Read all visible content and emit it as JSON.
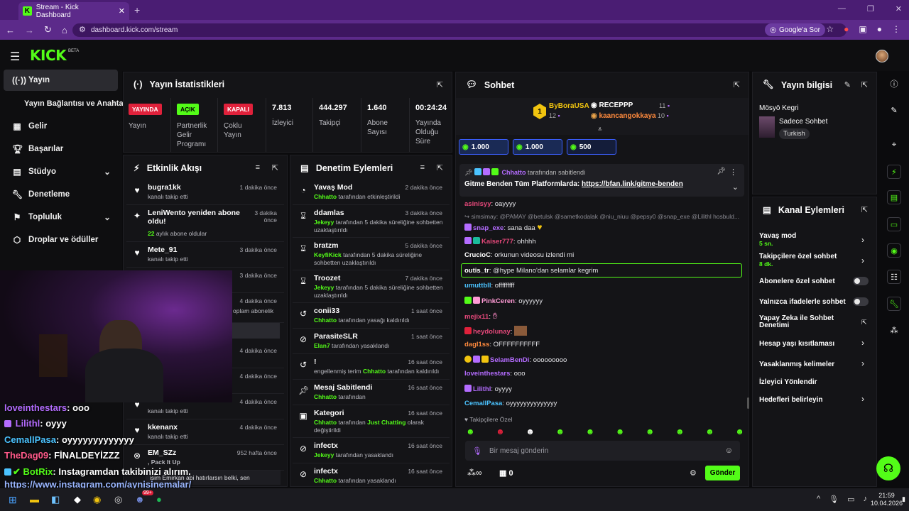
{
  "browser": {
    "tab_title": "Stream - Kick Dashboard",
    "url": "dashboard.kick.com/stream",
    "search_chip": "Google'a Sor"
  },
  "app": {
    "logo": "KICK",
    "beta": "BETA"
  },
  "sidebar": {
    "items": [
      {
        "label": "Yayın",
        "icon": "broadcast-icon"
      },
      {
        "label": "Yayın Bağlantısı ve Anahtarı",
        "icon": ""
      },
      {
        "label": "Gelir",
        "icon": "revenue-icon"
      },
      {
        "label": "Başarılar",
        "icon": "trophy-icon"
      },
      {
        "label": "Stüdyo",
        "icon": "studio-icon"
      },
      {
        "label": "Denetleme",
        "icon": "wrench-icon"
      },
      {
        "label": "Topluluk",
        "icon": "community-icon"
      },
      {
        "label": "Droplar ve ödüller",
        "icon": "drops-icon"
      }
    ]
  },
  "stats": {
    "title": "Yayın İstatistikleri",
    "cells": [
      {
        "badge": "YAYINDA",
        "label": "Yayın"
      },
      {
        "badge": "AÇIK",
        "label": "Partnerlik Gelir Programı"
      },
      {
        "badge": "KAPALI",
        "label": "Çoklu Yayın"
      },
      {
        "value": "7.813",
        "label": "İzleyici"
      },
      {
        "value": "444.297",
        "label": "Takipçi"
      },
      {
        "value": "1.640",
        "label": "Abone Sayısı"
      },
      {
        "value": "00:24:24",
        "label": "Yayında Olduğu Süre"
      }
    ]
  },
  "activity": {
    "title": "Etkinlik Akışı",
    "items": [
      {
        "name": "bugra1kk",
        "sub": "kanalı takip etti",
        "time": "1 dakika önce"
      },
      {
        "name": "LeniWento yeniden abone oldu!",
        "sub_num": "22",
        "sub": " aylık abone oldular",
        "time": "3 dakika önce"
      },
      {
        "name": "Mete_91",
        "sub": "kanalı takip etti",
        "time": "3 dakika önce"
      },
      {
        "time": "3 dakika önce"
      },
      {
        "sub": "oplam abonelik",
        "time": "4 dakika önce"
      },
      {
        "time": "4 dakika önce"
      },
      {
        "time": "4 dakika önce"
      },
      {
        "sub": "kanalı takip etti",
        "time": "4 dakika önce"
      },
      {
        "name": "kkenanx",
        "sub": "kanalı takip etti",
        "time": "4 dakika önce"
      },
      {
        "name": "EM_SZz",
        "sub": ", Pack It Up",
        "time": "952 hafta önce"
      },
      {
        "sub": "isim Emirkan abi hatırlarsın belki, sen"
      }
    ]
  },
  "moderation": {
    "title": "Denetim Eylemleri",
    "items": [
      {
        "name": "Yavaş Mod",
        "actor": "Chhatto",
        "rest": " tarafından etkinleştirildi",
        "time": "2 dakika önce"
      },
      {
        "name": "ddamlas",
        "actor": "Jekeyy",
        "rest": " tarafından 5 dakika süreliğine sohbetten uzaklaştırıldı",
        "time": "3 dakika önce"
      },
      {
        "name": "bratzm",
        "actor": "KeyfiKick",
        "rest": " tarafından 5 dakika süreliğine sohbetten uzaklaştırıldı",
        "time": "5 dakika önce"
      },
      {
        "name": "Troozet",
        "actor": "Jekeyy",
        "rest": " tarafından 5 dakika süreliğine sohbetten uzaklaştırıldı",
        "time": "7 dakika önce"
      },
      {
        "name": "conii33",
        "actor": "Chhatto",
        "rest": " tarafından yasağı kaldırıldı",
        "time": "1 saat önce"
      },
      {
        "name": "ParasiteSLR",
        "actor": "Elan7",
        "rest": " tarafından yasaklandı",
        "time": "1 saat önce"
      },
      {
        "name": "!",
        "pre": "engellenmiş terim ",
        "actor": "Chhatto",
        "rest": " tarafından kaldırıldı",
        "time": "16 saat önce"
      },
      {
        "name": "Mesaj Sabitlendi",
        "actor": "Chhatto",
        "rest": " tarafından",
        "time": "16 saat önce"
      },
      {
        "name": "Kategori",
        "actor": "Chhatto",
        "rest": " tarafından ",
        "actor2": "Just Chatting",
        "rest2": " olarak değiştirildi",
        "time": "16 saat önce"
      },
      {
        "name": "infectx",
        "actor": "Jekeyy",
        "rest": " tarafından yasaklandı",
        "time": "16 saat önce"
      },
      {
        "name": "infectx",
        "actor": "Chhatto",
        "rest": " tarafından yasaklandı",
        "time": "16 saat önce"
      }
    ]
  },
  "chat": {
    "title": "Sohbet",
    "leaders": [
      {
        "rank": "1",
        "name": "ByBoraUSA",
        "count": "12"
      },
      {
        "name": "RECEPPP",
        "count": "11"
      },
      {
        "name": "kaancangokkaya",
        "count": "10"
      }
    ],
    "kicks": [
      "1.000",
      "1.000",
      "500"
    ],
    "pinned_by": "Chhatto",
    "pinned_by_rest": " tarafından sabitlendi",
    "pinned_text": "Gitme Benden Tüm Platformlarda: ",
    "pinned_link": "https://bfan.link/gitme-benden",
    "lines": [
      {
        "user": "asinisyy",
        "color": "#e5487a",
        "text": ": oayyyy"
      },
      {
        "user": "",
        "color": "#8a8a92",
        "text": "simsimay: @PAMAY @betulsk @sametkodalak @niu_niuu @pepsy0 @snap_exe @Lilithl hosbuld..."
      },
      {
        "user": "snap_exe",
        "color": "#b46cff",
        "text": ": sana daa"
      },
      {
        "user": "Kaiser777",
        "color": "#e5487a",
        "text": ": ohhhh"
      },
      {
        "user": "CrucioC",
        "color": "#ffffff",
        "text": ": orkunun videosu izlendi mi"
      },
      {
        "user": "outis_tr",
        "color": "#ffffff",
        "text": ": @hype Milano'dan selamlar kegrim"
      },
      {
        "user": "umuttbll",
        "color": "#4bc3ff",
        "text": ": offfffffff"
      },
      {
        "user": "PinkCeren",
        "color": "#ff9ad5",
        "text": ": oyyyyyy"
      },
      {
        "user": "mejix11",
        "color": "#e5487a",
        "text": ":"
      },
      {
        "user": "heydolunay",
        "color": "#e5487a",
        "text": ":"
      },
      {
        "user": "dagl1ss",
        "color": "#ff8a3d",
        "text": ": OFFFFFFFFFF"
      },
      {
        "user": "SelamBenDi",
        "color": "#b46cff",
        "text": ": ooooooooo"
      },
      {
        "user": "loveinthestars",
        "color": "#b46cff",
        "text": ": ooo"
      },
      {
        "user": "Lilithl",
        "color": "#b46cff",
        "text": ": oyyyy"
      },
      {
        "user": "CemallPasa",
        "color": "#4bc3ff",
        "text": ": oyyyyyyyyyyyyyy"
      }
    ],
    "followers_only": "Takipçilere Özel",
    "input_placeholder": "Bir mesaj gönderin",
    "counter": "0",
    "send": "Gönder"
  },
  "stream_info": {
    "title": "Yayın bilgisi",
    "stream_title": "Mösyö Kegri",
    "category": "Sadece Sohbet",
    "language": "Turkish"
  },
  "channel_actions": {
    "title": "Kanal Eylemleri",
    "items": [
      {
        "label": "Yavaş mod",
        "sub": "5 sn."
      },
      {
        "label": "Takipçilere özel sohbet",
        "sub": "8 dk."
      },
      {
        "label": "Abonelere özel sohbet"
      },
      {
        "label": "Yalnızca ifadelerle sohbet"
      },
      {
        "label": "Yapay Zeka ile Sohbet Denetimi"
      },
      {
        "label": "Hesap yaşı kısıtlaması"
      },
      {
        "label": "Yasaklanmış kelimeler"
      },
      {
        "label": "İzleyici Yönlendir"
      },
      {
        "label": "Hedefleri belirleyin"
      }
    ]
  },
  "overlay": {
    "lines": [
      {
        "user": "loveinthestars",
        "text": ": ooo",
        "color": "#b46cff"
      },
      {
        "user": "Lilithl",
        "text": ": oyyy",
        "color": "#b46cff"
      },
      {
        "user": "CemallPasa",
        "text": ": oyyyyyyyyyyyyy",
        "color": "#4bc3ff"
      },
      {
        "user": "TheDag09",
        "text": ": FİNALDEYİZZZ",
        "color": "#ff5a8a"
      },
      {
        "user": "BotRix",
        "text": ": Instagramdan takibinizi alırım.",
        "color": "#53fc18"
      }
    ],
    "link": "https://www.instagram.com/aynisinemalar/"
  },
  "taskbar": {
    "time": "21:59",
    "date": "10.04.2026",
    "badge": "99+"
  },
  "colors": {
    "accent": "#53fc18",
    "browser": "#5c2a8a",
    "panel": "#141417"
  }
}
